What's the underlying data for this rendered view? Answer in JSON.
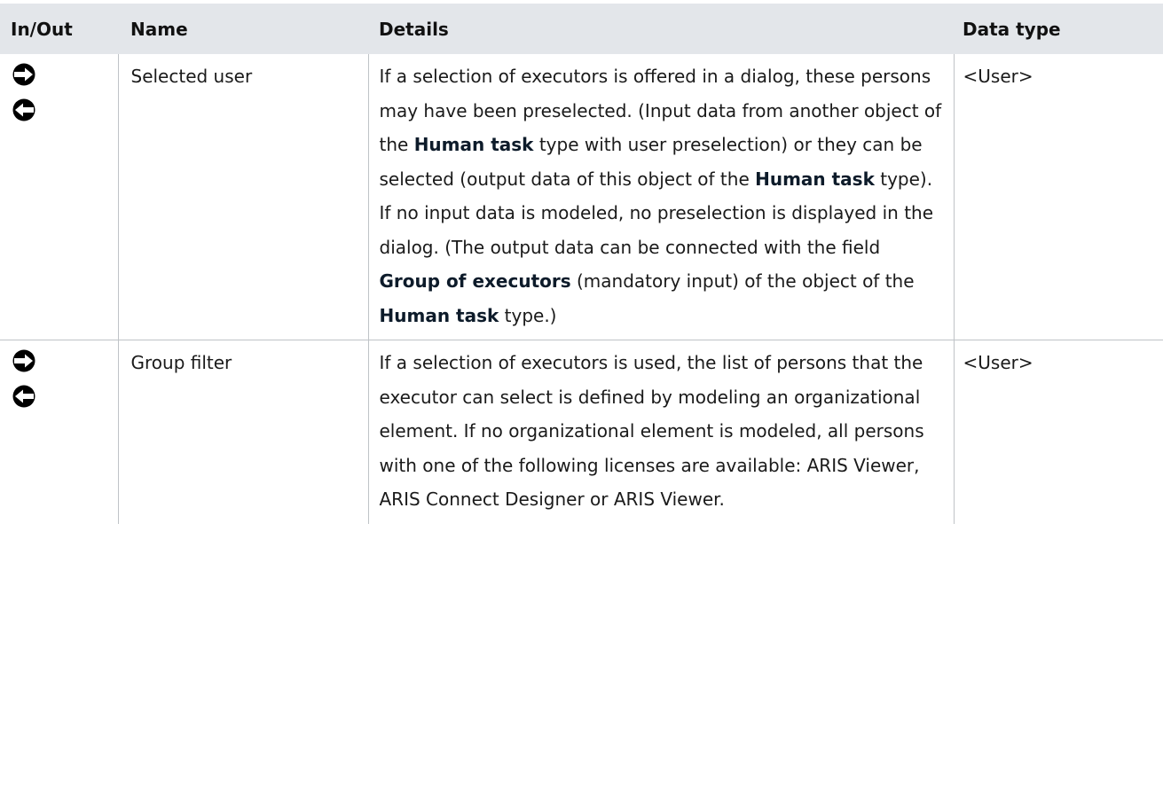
{
  "table": {
    "headers": {
      "inout": "In/Out",
      "name": "Name",
      "details": "Details",
      "datatype": "Data type"
    },
    "rows": [
      {
        "icons": [
          "arrow-right-icon",
          "arrow-left-icon"
        ],
        "name": "Selected user",
        "details": {
          "t1": "If a selection of executors is offered in a dialog, these persons may have been preselected. (Input data from another object of the ",
          "b1": "Human task",
          "t2": " type with user preselection) or they can be selected (output data of this object of the ",
          "b2": "Human task",
          "t3": " type). If no input data is modeled, no preselection is displayed in the dialog. (The output data can be connected with the field ",
          "b3": "Group of executors",
          "t4": " (mandatory input) of the object of the ",
          "b4": "Human task",
          "t5": " type.)"
        },
        "datatype": "<User>"
      },
      {
        "icons": [
          "arrow-right-icon",
          "arrow-left-icon"
        ],
        "name": "Group filter",
        "details": {
          "t1": "If a selection of executors is used, the list of persons that the executor can select is defined by modeling an organizational element. If no organizational element is modeled, all persons with one of the following licenses are available: ARIS Viewer, ARIS Connect Designer or ARIS Viewer."
        },
        "datatype": "<User>"
      }
    ]
  },
  "colors": {
    "header_bg": "#e3e6ea",
    "border": "#bfc3c7",
    "text": "#1a1a1a"
  }
}
